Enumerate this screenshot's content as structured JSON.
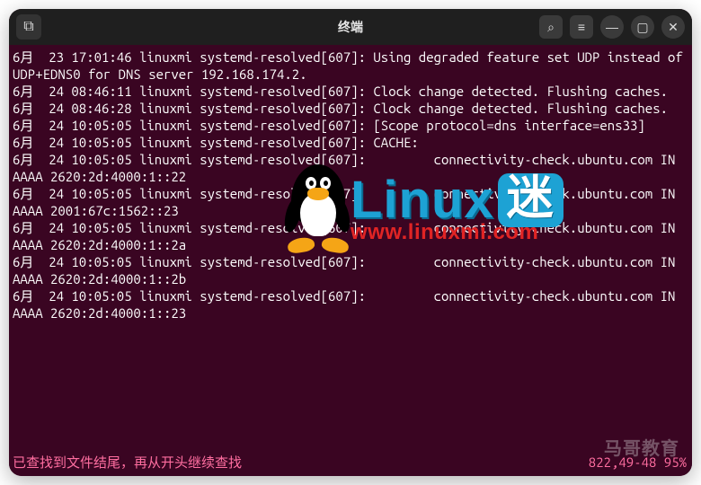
{
  "window": {
    "title": "终端"
  },
  "titlebar_icons": {
    "new_tab": "⧉",
    "search": "⌕",
    "menu": "≡",
    "minimize": "—",
    "maximize": "▢",
    "close": "✕"
  },
  "log_lines": [
    "6月  23 17:01:46 linuxmi systemd-resolved[607]: Using degraded feature set UDP instead of UDP+EDNS0 for DNS server 192.168.174.2.",
    "6月  24 08:46:11 linuxmi systemd-resolved[607]: Clock change detected. Flushing caches.",
    "6月  24 08:46:28 linuxmi systemd-resolved[607]: Clock change detected. Flushing caches.",
    "6月  24 10:05:05 linuxmi systemd-resolved[607]: [Scope protocol=dns interface=ens33]",
    "6月  24 10:05:05 linuxmi systemd-resolved[607]: CACHE:",
    "6月  24 10:05:05 linuxmi systemd-resolved[607]:         connectivity-check.ubuntu.com IN AAAA 2620:2d:4000:1::22",
    "6月  24 10:05:05 linuxmi systemd-resolved[607]:         connectivity-check.ubuntu.com IN AAAA 2001:67c:1562::23",
    "6月  24 10:05:05 linuxmi systemd-resolved[607]:         connectivity-check.ubuntu.com IN AAAA 2620:2d:4000:1::2a",
    "6月  24 10:05:05 linuxmi systemd-resolved[607]:         connectivity-check.ubuntu.com IN AAAA 2620:2d:4000:1::2b",
    "6月  24 10:05:05 linuxmi systemd-resolved[607]:         connectivity-check.ubuntu.com IN AAAA 2620:2d:4000:1::23"
  ],
  "status": {
    "left": "已查找到文件结尾，再从开头继续查找",
    "right": "822,49-48     95%"
  },
  "watermark": {
    "brand_latin": "Linux",
    "brand_cjk": "迷",
    "url": "www.linuxmi.com",
    "corner": "马哥教育"
  }
}
